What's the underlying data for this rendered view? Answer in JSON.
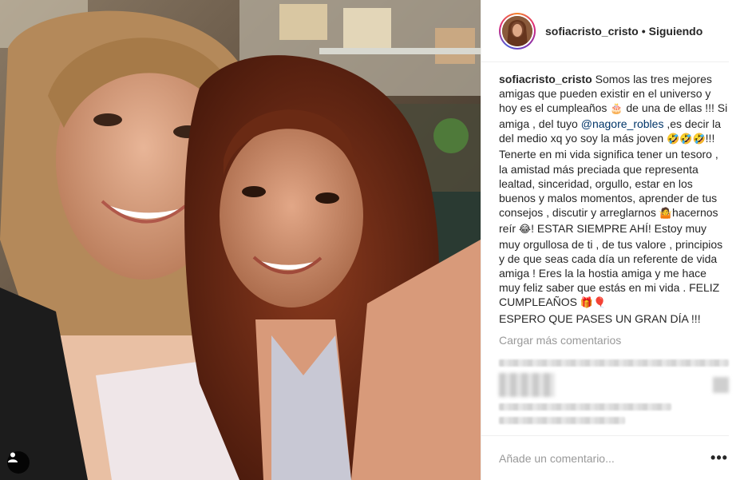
{
  "header": {
    "username": "sofiacristo_cristo",
    "separator": "•",
    "follow_status": "Siguiendo"
  },
  "caption": {
    "username": "sofiacristo_cristo",
    "line1": "Somos las tres mejores amigas que pueden existir en el universo y hoy es el cumpleaños ",
    "emoji_cake": "🎂",
    "line2": " de una de ellas !!! Si amiga , del tuyo ",
    "mention": "@nagore_robles",
    "line3": " ,es decir la del medio xq yo soy la más joven ",
    "emoji_laugh": "🤣🤣🤣",
    "line4": "!!!",
    "paragraph2_a": "Tenerte en mi vida significa tener un tesoro , la amistad más preciada que representa lealtad, sinceridad, orgullo, estar en los buenos y malos momentos, aprender de tus consejos , discutir y arreglarnos ",
    "emoji_shrug": "🤷",
    "paragraph2_b": "hacernos reír ",
    "emoji_joy": "😂",
    "paragraph2_c": "! ESTAR SIEMPRE AHÍ! Estoy muy muy orgullosa de ti , de tus valore , principios y de que seas cada día un referente de vida amiga ! Eres la la hostia amiga y me hace muy feliz saber que estás en mi vida . FELIZ CUMPLEAÑOS ",
    "emoji_gift": "🎁🎈",
    "paragraph2_d": "ESPERO QUE PASES UN GRAN DÍA !!!"
  },
  "comments": {
    "load_more_label": "Cargar más comentarios"
  },
  "footer": {
    "comment_placeholder": "Añade un comentario...",
    "more_label": "•••"
  },
  "icons": {
    "tag": "user-tag-icon",
    "more": "more-options-icon"
  },
  "colors": {
    "mention": "#003569",
    "muted": "#999999",
    "text": "#262626",
    "border": "#efefef"
  }
}
